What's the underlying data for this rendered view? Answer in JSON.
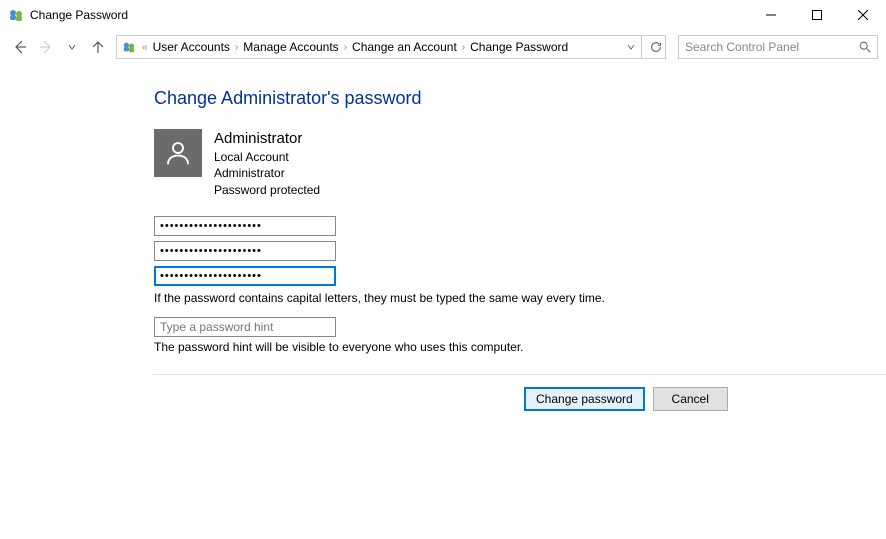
{
  "window": {
    "title": "Change Password"
  },
  "breadcrumb": {
    "overflow_indicator": "«",
    "items": [
      "User Accounts",
      "Manage Accounts",
      "Change an Account",
      "Change Password"
    ]
  },
  "search": {
    "placeholder": "Search Control Panel"
  },
  "page": {
    "heading": "Change Administrator's password"
  },
  "user": {
    "name": "Administrator",
    "account_type": "Local Account",
    "role": "Administrator",
    "protection": "Password protected"
  },
  "fields": {
    "current_password": "•••••••••••••••••••••",
    "new_password": "•••••••••••••••••••••",
    "confirm_password": "•••••••••••••••••••••",
    "caps_helper": "If the password contains capital letters, they must be typed the same way every time.",
    "hint_placeholder": "Type a password hint",
    "hint_value": "",
    "hint_helper": "The password hint will be visible to everyone who uses this computer."
  },
  "buttons": {
    "primary": "Change password",
    "secondary": "Cancel"
  }
}
